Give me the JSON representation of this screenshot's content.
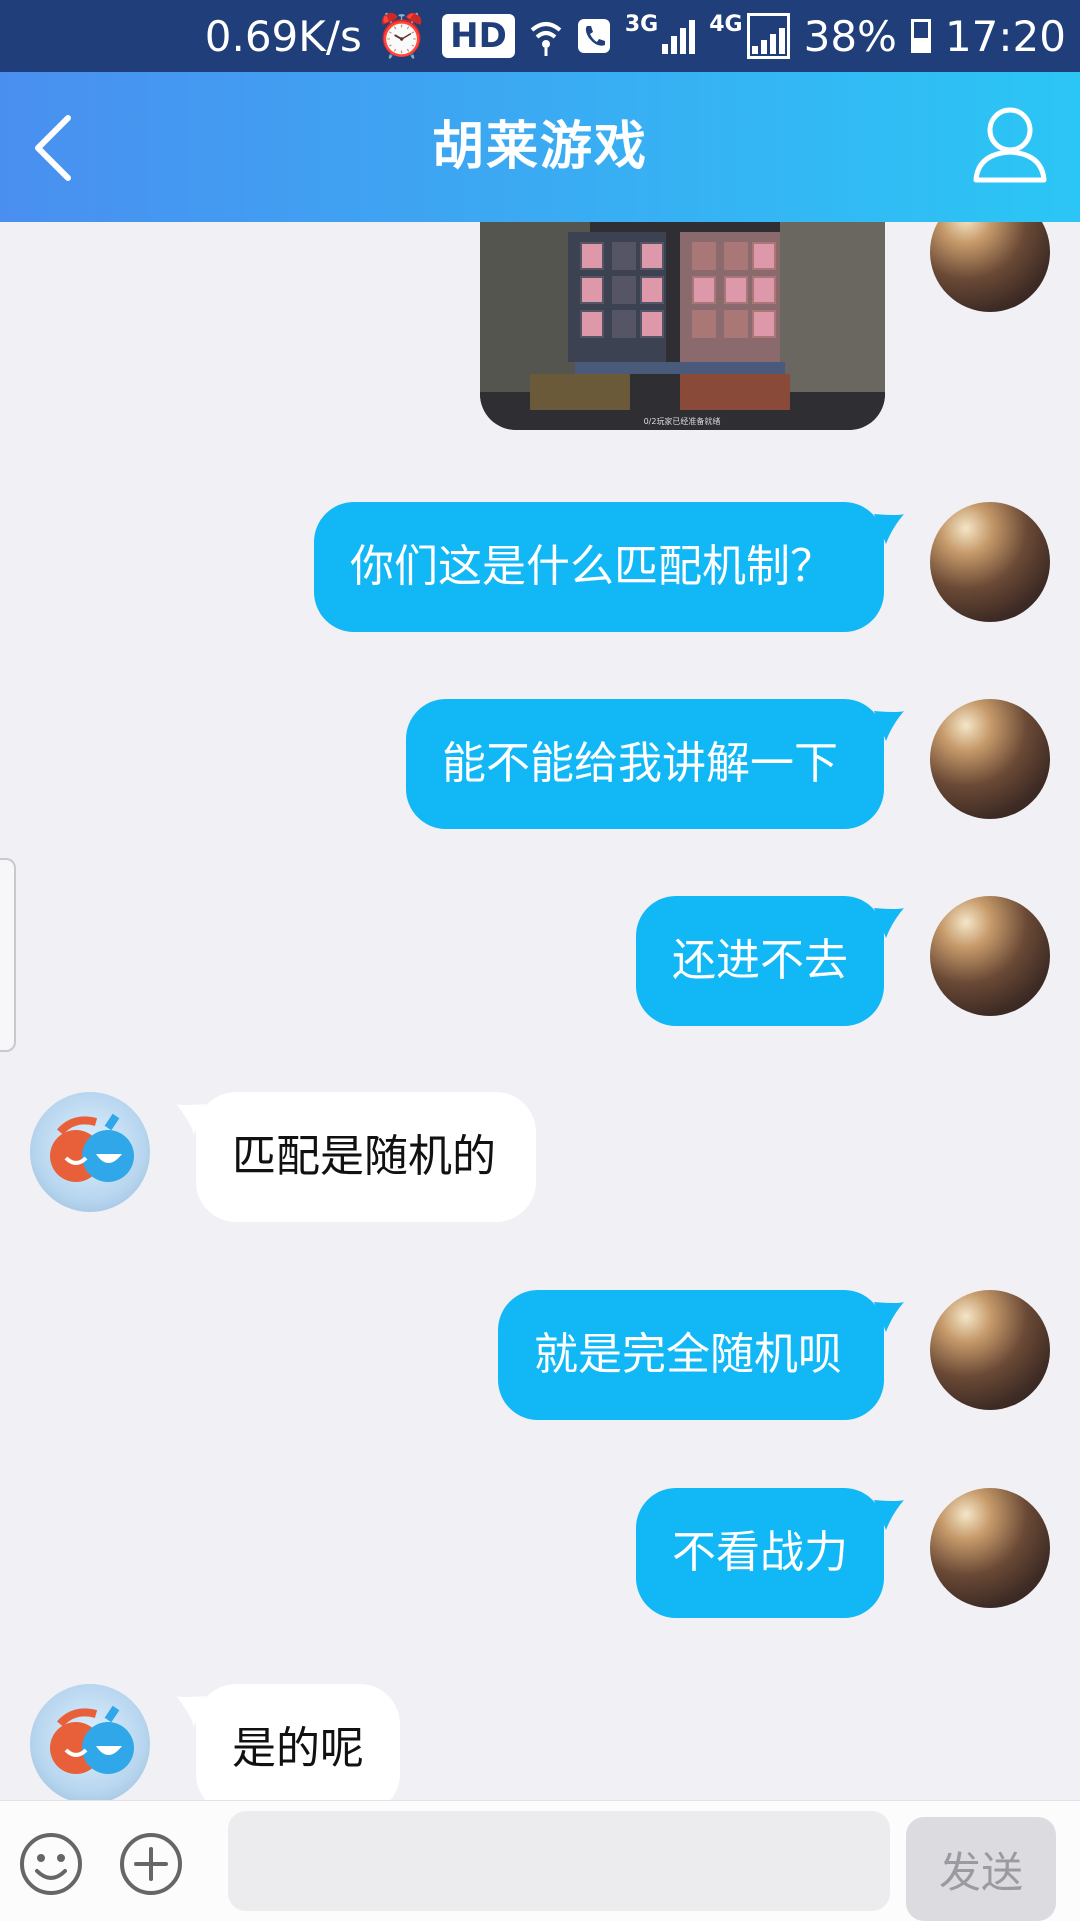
{
  "status_bar": {
    "net_speed": "0.69K/s",
    "hd": "HD",
    "net_3g": "3G",
    "net_4g": "4G",
    "battery": "38%",
    "time": "17:20"
  },
  "header": {
    "title": "胡莱游戏",
    "back_icon": "chevron-left-icon",
    "profile_icon": "person-icon"
  },
  "messages": [
    {
      "side": "me",
      "type": "image",
      "image_text": "0/2玩家已经准备就绪"
    },
    {
      "side": "me",
      "text": "你们这是什么匹配机制？"
    },
    {
      "side": "me",
      "text": "能不能给我讲解一下"
    },
    {
      "side": "me",
      "text": "还进不去"
    },
    {
      "side": "other",
      "text": "匹配是随机的"
    },
    {
      "side": "me",
      "text": "就是完全随机呗"
    },
    {
      "side": "me",
      "text": "不看战力"
    },
    {
      "side": "other",
      "text": "是的呢"
    }
  ],
  "input_bar": {
    "emoji_icon": "smiley-icon",
    "plus_icon": "plus-circle-icon",
    "input_value": "",
    "send_label": "发送"
  },
  "colors": {
    "status_bar": "#1f3e7a",
    "title_gradient_start": "#4a8ff0",
    "title_gradient_end": "#2bc6f5",
    "my_bubble": "#12b7f5",
    "other_bubble": "#ffffff",
    "chat_bg": "#f0f0f5"
  }
}
